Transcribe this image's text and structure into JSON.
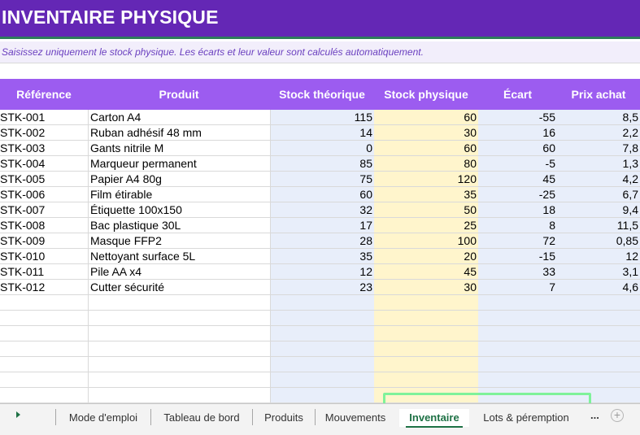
{
  "title": "INVENTAIRE PHYSIQUE",
  "subtitle": "Saisissez uniquement le stock physique. Les écarts et leur valeur sont calculés automatiquement.",
  "columns": [
    "Référence",
    "Produit",
    "Stock théorique",
    "Stock physique",
    "Écart",
    "Prix achat"
  ],
  "rows": [
    [
      "STK-001",
      "Carton A4",
      "115",
      "60",
      "-55",
      "8,5"
    ],
    [
      "STK-002",
      "Ruban adhésif 48 mm",
      "14",
      "30",
      "16",
      "2,2"
    ],
    [
      "STK-003",
      "Gants nitrile M",
      "0",
      "60",
      "60",
      "7,8"
    ],
    [
      "STK-004",
      "Marqueur permanent",
      "85",
      "80",
      "-5",
      "1,3"
    ],
    [
      "STK-005",
      "Papier A4 80g",
      "75",
      "120",
      "45",
      "4,2"
    ],
    [
      "STK-006",
      "Film étirable",
      "60",
      "35",
      "-25",
      "6,7"
    ],
    [
      "STK-007",
      "Étiquette 100x150",
      "32",
      "50",
      "18",
      "9,4"
    ],
    [
      "STK-008",
      "Bac plastique 30L",
      "17",
      "25",
      "8",
      "11,5"
    ],
    [
      "STK-009",
      "Masque FFP2",
      "28",
      "100",
      "72",
      "0,85"
    ],
    [
      "STK-010",
      "Nettoyant surface 5L",
      "35",
      "20",
      "-15",
      "12"
    ],
    [
      "STK-011",
      "Pile AA x4",
      "12",
      "45",
      "33",
      "3,1"
    ],
    [
      "STK-012",
      "Cutter sécurité",
      "23",
      "30",
      "7",
      "4,6"
    ]
  ],
  "tabs": [
    {
      "label": "Mode d'emploi",
      "active": false
    },
    {
      "label": "Tableau de bord",
      "active": false
    },
    {
      "label": "Produits",
      "active": false
    },
    {
      "label": "Mouvements",
      "active": false
    },
    {
      "label": "Inventaire",
      "active": true
    },
    {
      "label": "Lots & péremption",
      "active": false
    }
  ],
  "tab_overflow": "...",
  "colors": {
    "title_bg": "#6427b5",
    "header_bg": "#9c5cf0",
    "theoretical_col_bg": "#e8eefa",
    "physical_col_bg": "#fff5cc",
    "active_tab": "#1e7145",
    "highlight": "#7ff29a"
  },
  "icons": {
    "nav": "play-right-icon",
    "add_sheet": "plus-circle-icon"
  }
}
